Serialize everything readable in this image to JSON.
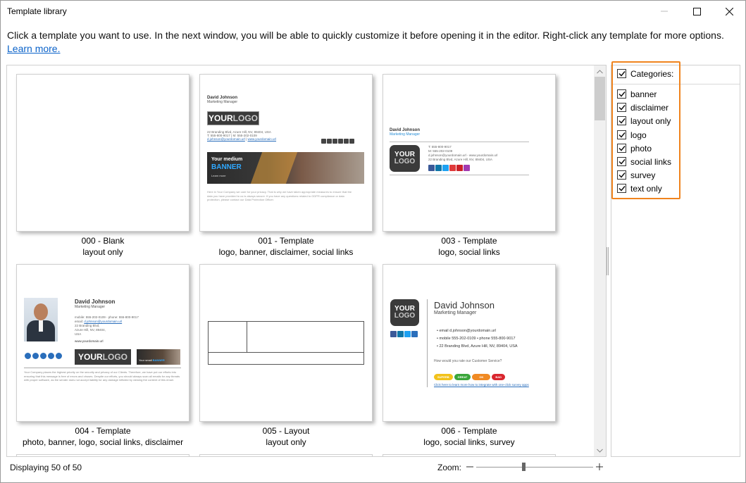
{
  "window": {
    "title": "Template library"
  },
  "intro": {
    "text": "Click a template you want to use. In the next window, you will be able to quickly customize it before opening it in the editor. Right-click any template for more options.",
    "link": "Learn more."
  },
  "templates": [
    {
      "name": "000 - Blank",
      "categories": "layout only"
    },
    {
      "name": "001 - Template",
      "categories": "logo, banner, disclaimer, social links"
    },
    {
      "name": "003 - Template",
      "categories": "logo, social links"
    },
    {
      "name": "004 - Template",
      "categories": "photo, banner, logo, social links, disclaimer"
    },
    {
      "name": "005 - Layout",
      "categories": "layout only"
    },
    {
      "name": "006 - Template",
      "categories": "logo, social links, survey"
    }
  ],
  "preview": {
    "person": "David Johnson",
    "role": "Marketing Manager",
    "logo_your": "YOUR",
    "logo_logo": "LOGO",
    "t001": {
      "address": "22 Branding Blvd, Azure Hill, NV, 89404, USA",
      "phones": "T: 555-800-9017 | M: 555-202-0109",
      "email": "d.johnson@yourdomain.url",
      "sep": " | ",
      "website": "www.yourdomain.url",
      "banner_small": "Your medium",
      "banner_big": "BANNER",
      "banner_cta": "Learn more",
      "disclaimer": "Here in Your Company we care for your privacy. That is why we have taken appropriate measures to ensure that the data you have provided to us is always secure. If you have any questions related to GDPR compliance or data protection, please contact our Data Protection Officer."
    },
    "t003": {
      "t": "T: 555-800-9017",
      "m": "M: 555-202-0109",
      "email_web": "d.johnson@yourdomain.url - www.yourdomain.url",
      "address": "22 Branding Blvd, Azure Hill, NV, 89404, USA"
    },
    "t004": {
      "phones": "mobile: 555-202-0109 - phone: 555-800-9017",
      "email_label": "email:",
      "email": "d.johnson@yourdomain.url",
      "addr1": "22 Branding Blvd,",
      "addr2": "Azure Hill, NV, 89404,",
      "addr3": "USA",
      "website": "www.yourdomain.url",
      "banner_small": "Your small",
      "banner_big": "BANNER",
      "disclaimer": "Your Company places the highest priority on the security and privacy of our Clients. Therefore, we have put our efforts into ensuring that this message is free of errors and viruses. Despite our efforts, you should always scan all emails for any threats with proper software, as the sender does not accept liability for any damage inflicted by viewing the content of this email."
    },
    "t006": {
      "email": "email d.johnson@yourdomain.url",
      "phones": "mobile 555-202-0109 • phone 555-800-9017",
      "address": "22 Branding Blvd, Azure Hill, NV, 89404, USA",
      "survey_q": "How would you rate our Customer Service?",
      "ratings": [
        "SUPERB",
        "GREAT",
        "OK",
        "BAD"
      ],
      "survey_link": "Click here to learn more how to integrate with one-click survey apps"
    }
  },
  "categories": {
    "header": "Categories:",
    "items": [
      "banner",
      "disclaimer",
      "layout only",
      "logo",
      "photo",
      "social links",
      "survey",
      "text only"
    ]
  },
  "status": {
    "displaying": "Displaying 50 of 50",
    "zoom_label": "Zoom:",
    "zoom_level": 0.45
  },
  "colors": {
    "accent_highlight": "#f0841e",
    "link": "#0a62c9"
  }
}
